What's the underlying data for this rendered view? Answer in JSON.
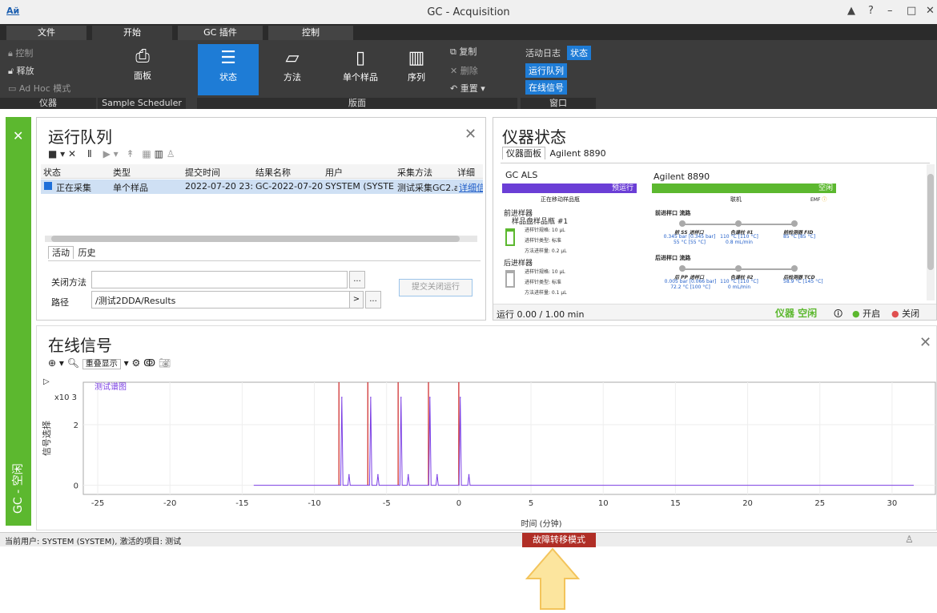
{
  "app": {
    "logo": "Aй",
    "title": "GC - Acquisition",
    "window_controls": [
      "▲",
      "?",
      "–",
      "□",
      "✕"
    ]
  },
  "tabs": [
    {
      "label": "文件"
    },
    {
      "label": "开始"
    },
    {
      "label": "GC 插件"
    },
    {
      "label": "控制"
    }
  ],
  "ribbon": {
    "instrument_group": {
      "items": [
        "控制",
        "释放",
        "Ad Hoc 模式"
      ],
      "label": "仪器"
    },
    "scheduler_group": {
      "panel_btn": "面板",
      "label": "Sample Scheduler"
    },
    "layout_group": {
      "buttons": [
        "状态",
        "方法",
        "单个样品",
        "序列"
      ],
      "label": "版面",
      "copy": "复制",
      "delete": "删除",
      "reset": "重置"
    },
    "window_group": {
      "items": [
        "活动日志",
        "状态",
        "运行队列",
        "在线信号"
      ],
      "label": "窗口"
    }
  },
  "sidebar": {
    "label": "GC - 空闲"
  },
  "run_queue": {
    "title": "运行队列",
    "columns": [
      "状态",
      "类型",
      "提交时间",
      "结果名称",
      "用户",
      "采集方法",
      "详细"
    ],
    "rows": [
      [
        "正在采集",
        "单个样品",
        "2022-07-20 23:",
        "GC-2022-07-20",
        "SYSTEM (SYSTE",
        "测试采集GC2.am",
        "详细信"
      ]
    ],
    "subtabs": [
      "活动",
      "历史"
    ],
    "close_method_label": "关闭方法",
    "close_method_value": "",
    "path_label": "路径",
    "path_value": "/测试2DDA/Results",
    "submit_button": "提交关闭运行",
    "ellipsis": "...",
    "arrow": ">"
  },
  "instrument_status": {
    "title": "仪器状态",
    "tabs": [
      "仪器面板",
      "Agilent 8890"
    ],
    "als": {
      "title": "GC ALS",
      "state": "预运行",
      "substate": "正在移动样品瓶",
      "front": "前进样器",
      "tray": "样品盘样品瓶 #1",
      "front_details": [
        "进样针规格: 10 μL",
        "进样针类型: 标准",
        "方法进样量: 0.2 μL"
      ],
      "back": "后进样器",
      "back_details": [
        "进样针规格: 10 μL",
        "进样针类型: 标准",
        "方法进样量: 0.1 μL"
      ],
      "state_color": "#6b3ed6"
    },
    "gc": {
      "title": "Agilent 8890",
      "state": "空闲",
      "mode": "联机",
      "emf": "EMF",
      "front_label": "前进样口 流路",
      "front_nodes": [
        {
          "name": "前 SS 进样口",
          "val": "0.345 bar [0.345 bar]\n55 °C [55 °C]"
        },
        {
          "name": "色谱柱 #1",
          "val": "110 °C [110 °C]\n0.8 mL/min"
        },
        {
          "name": "前检测器 FID",
          "val": "85 °C [85 °C]"
        }
      ],
      "back_label": "后进样口 流路",
      "back_nodes": [
        {
          "name": "后 PP 进样口",
          "val": "0.005 bar [0.066 bar]\n72.2 °C [100 °C]"
        },
        {
          "name": "色谱柱 #2",
          "val": "110 °C [110 °C]\n0 mL/min"
        },
        {
          "name": "后检测器 TCD",
          "val": "58.9 °C [145 °C]"
        }
      ],
      "state_color": "#5cb82f"
    },
    "run_text": "运行 0.00 / 1.00 min",
    "idle": "仪器 空闲",
    "on": "开启",
    "off": "关闭"
  },
  "online_signal": {
    "title": "在线信号",
    "overlay": "重叠显示",
    "chart_title": "测试谱图",
    "ylabel": "信号选择",
    "xlabel": "时间 (分钟)",
    "yexp": "x10 3"
  },
  "chart_data": {
    "type": "line",
    "title": "测试谱图",
    "xlabel": "时间 (分钟)",
    "ylabel": "信号选择",
    "xlim": [
      -26,
      33
    ],
    "ylim": [
      -0.3,
      3.4
    ],
    "x_ticks": [
      -25,
      -20,
      -15,
      -10,
      -5,
      0,
      5,
      10,
      15,
      20,
      25,
      30
    ],
    "y_ticks": [
      0,
      2
    ],
    "peaks": [
      {
        "t": -8.1,
        "h": 2.9
      },
      {
        "t": -7.6,
        "h": 0.35
      },
      {
        "t": -6.1,
        "h": 2.9
      },
      {
        "t": -5.6,
        "h": 0.35
      },
      {
        "t": -4.0,
        "h": 2.9
      },
      {
        "t": -3.5,
        "h": 0.35
      },
      {
        "t": -2.0,
        "h": 2.9
      },
      {
        "t": -1.5,
        "h": 0.35
      },
      {
        "t": 0.1,
        "h": 2.9
      },
      {
        "t": 0.7,
        "h": 0.35
      }
    ],
    "baseline_range": [
      -14.2,
      31.5
    ],
    "markers": [
      -8.3,
      -6.3,
      -4.2,
      -2.1,
      0.0
    ],
    "line_color": "#7b3fe4",
    "marker_color": "#cc2222"
  },
  "statusbar": {
    "text": "当前用户: SYSTEM (SYSTEM), 激活的项目: 测试",
    "failover": "故障转移模式"
  }
}
